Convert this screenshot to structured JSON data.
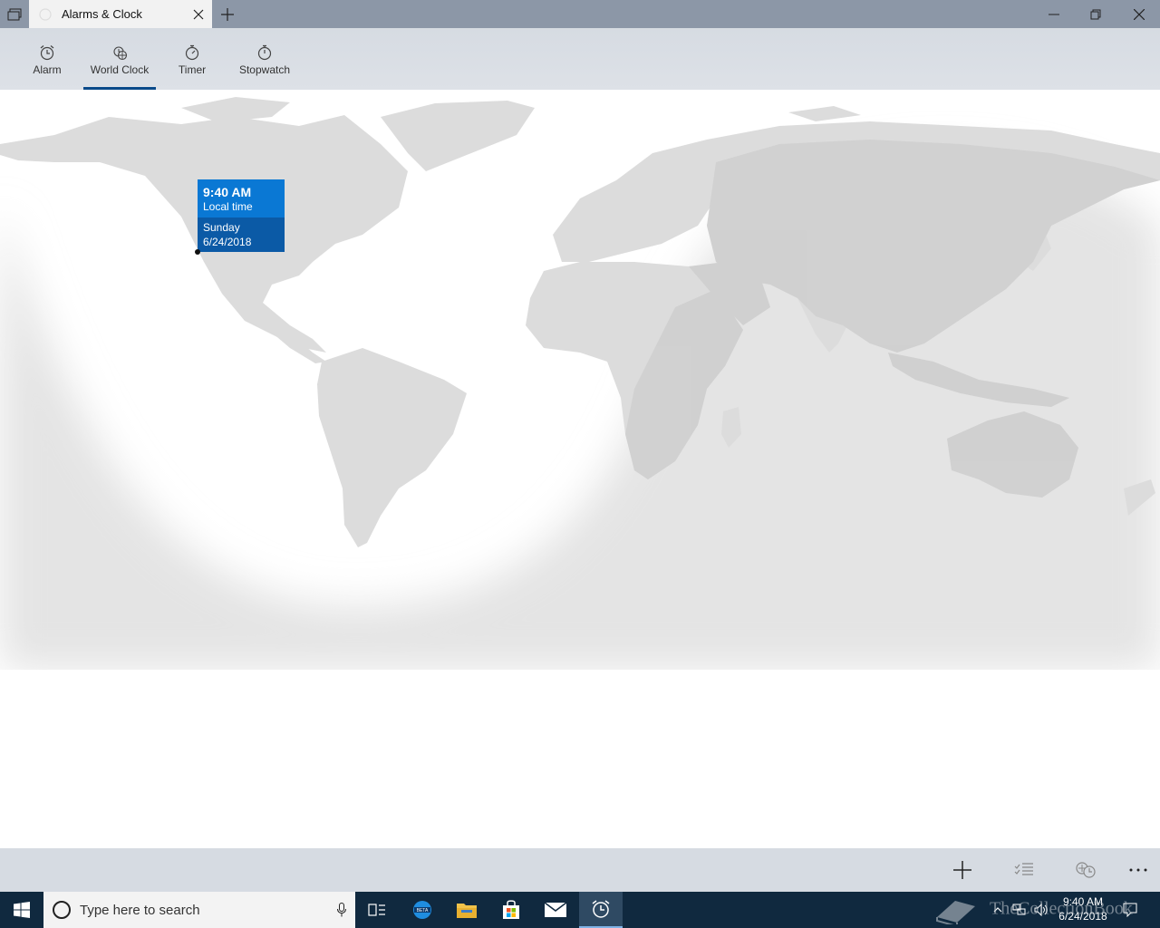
{
  "window": {
    "title": "Alarms & Clock"
  },
  "nav": {
    "items": [
      {
        "label": "Alarm",
        "icon": "alarm-icon"
      },
      {
        "label": "World Clock",
        "icon": "world-clock-icon",
        "active": true
      },
      {
        "label": "Timer",
        "icon": "timer-icon"
      },
      {
        "label": "Stopwatch",
        "icon": "stopwatch-icon"
      }
    ],
    "accent": "#0a4a8a"
  },
  "map": {
    "tooltip": {
      "time": "9:40 AM",
      "label": "Local time",
      "day": "Sunday",
      "date": "6/24/2018"
    }
  },
  "commandbar": {
    "icons": [
      "add-icon",
      "edit-list-icon",
      "compare-clocks-icon",
      "more-icon"
    ]
  },
  "taskbar": {
    "search_placeholder": "Type here to search",
    "apps": [
      "task-view-icon",
      "edge-beta-icon",
      "file-explorer-icon",
      "store-icon",
      "mail-icon",
      "alarms-clock-icon"
    ],
    "clock_time": "9:40 AM",
    "clock_date": "6/24/2018",
    "watermark": "TheCollectionBook"
  },
  "colors": {
    "titlebar": "#8c97a7",
    "tooltip_top": "#0a78d4",
    "tooltip_bottom": "#0b5aa6",
    "taskbar": "#10293f"
  }
}
